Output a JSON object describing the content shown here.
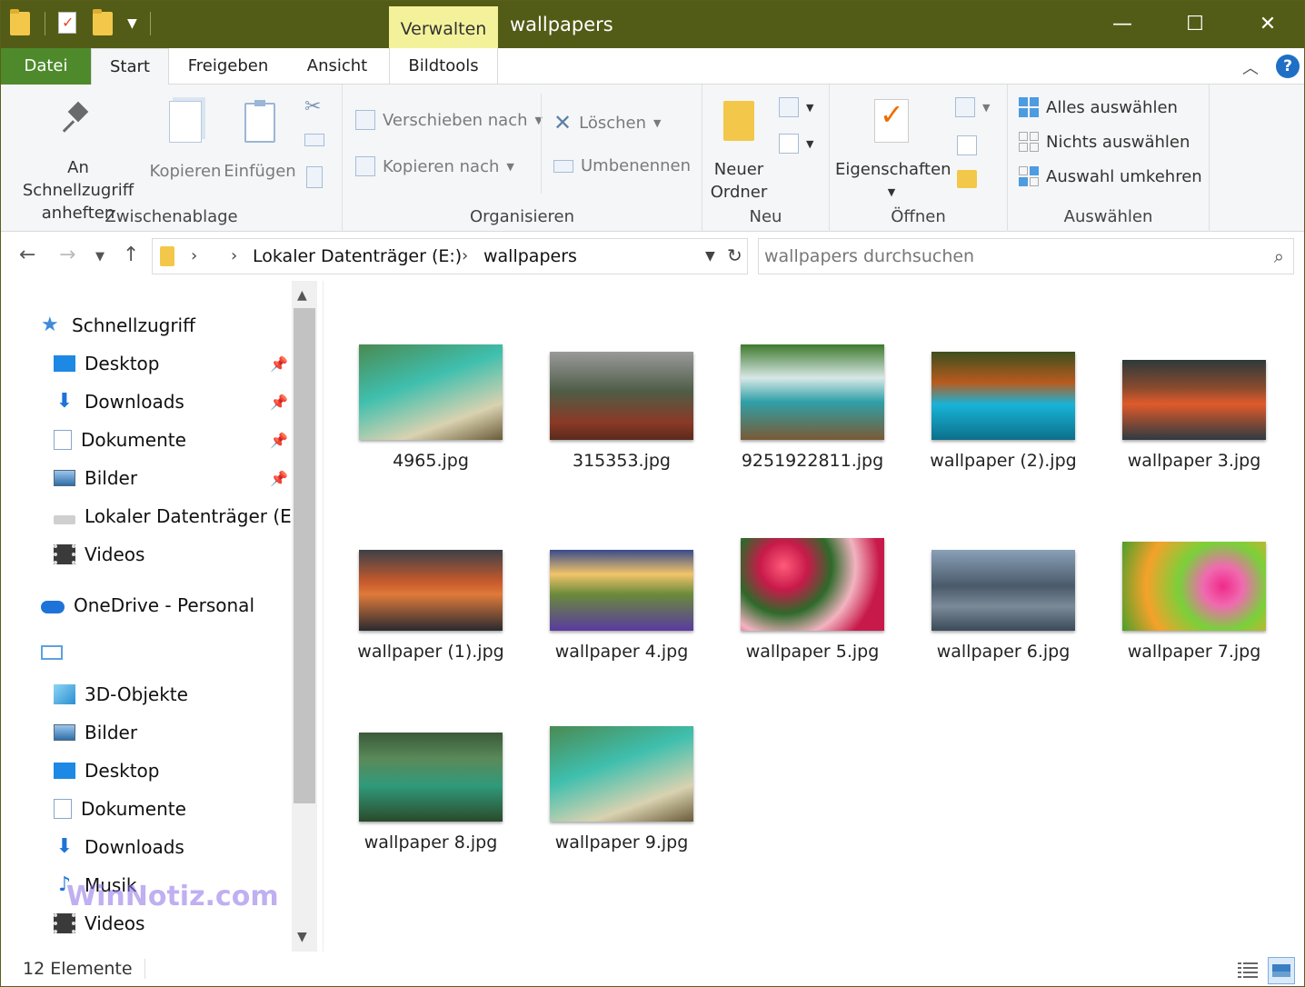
{
  "window": {
    "title": "wallpapers",
    "context_tab": "Verwalten",
    "minimize": "—",
    "maximize": "☐",
    "close": "✕"
  },
  "ribbon_tabs": [
    "Datei",
    "Start",
    "Freigeben",
    "Ansicht",
    "Bildtools"
  ],
  "ribbon": {
    "clipboard": {
      "pin_line1": "An Schnellzugriff",
      "pin_line2": "anheften",
      "copy": "Kopieren",
      "paste": "Einfügen",
      "label": "Zwischenablage"
    },
    "organize": {
      "move_to": "Verschieben nach",
      "copy_to": "Kopieren nach",
      "delete": "Löschen",
      "rename": "Umbenennen",
      "label": "Organisieren"
    },
    "new": {
      "new_folder_line1": "Neuer",
      "new_folder_line2": "Ordner",
      "label": "Neu"
    },
    "open": {
      "properties": "Eigenschaften",
      "label": "Öffnen"
    },
    "select": {
      "select_all": "Alles auswählen",
      "select_none": "Nichts auswählen",
      "invert": "Auswahl umkehren",
      "label": "Auswählen"
    }
  },
  "address": {
    "segments": [
      "Lokaler Datenträger (E:)",
      "wallpapers"
    ],
    "search_placeholder": "wallpapers durchsuchen"
  },
  "nav": {
    "quick_access": "Schnellzugriff",
    "quick_items": [
      "Desktop",
      "Downloads",
      "Dokumente",
      "Bilder",
      "Lokaler Datenträger (E:)",
      "Videos"
    ],
    "onedrive": "OneDrive - Personal",
    "pc_items": [
      "3D-Objekte",
      "Bilder",
      "Desktop",
      "Dokumente",
      "Downloads",
      "Musik",
      "Videos"
    ]
  },
  "files": [
    {
      "name": "4965.jpg",
      "icon": "beach-boat-image"
    },
    {
      "name": "315353.jpg",
      "icon": "forest-fog-image"
    },
    {
      "name": "9251922811.jpg",
      "icon": "waterfall-image"
    },
    {
      "name": "wallpaper  (2).jpg",
      "icon": "lake-autumn-image"
    },
    {
      "name": "wallpaper  3.jpg",
      "icon": "lake-sunset-image"
    },
    {
      "name": "wallpaper (1).jpg",
      "icon": "mountain-lake-image"
    },
    {
      "name": "wallpaper 4.jpg",
      "icon": "lavender-field-image"
    },
    {
      "name": "wallpaper 5.jpg",
      "icon": "roses-image"
    },
    {
      "name": "wallpaper 6.jpg",
      "icon": "misty-pagoda-image"
    },
    {
      "name": "wallpaper 7.jpg",
      "icon": "gerbera-flowers-image"
    },
    {
      "name": "wallpaper 8.jpg",
      "icon": "forest-lake-image"
    },
    {
      "name": "wallpaper 9.jpg",
      "icon": "beach-boat-image"
    }
  ],
  "status": {
    "count": "12 Elemente"
  },
  "watermark": "WinNotiz.com",
  "colors": {
    "titlebar": "#525c16",
    "datei_tab": "#4e8a2c",
    "context_tab": "#f3f29a",
    "accent_blue": "#1e6fc5"
  }
}
